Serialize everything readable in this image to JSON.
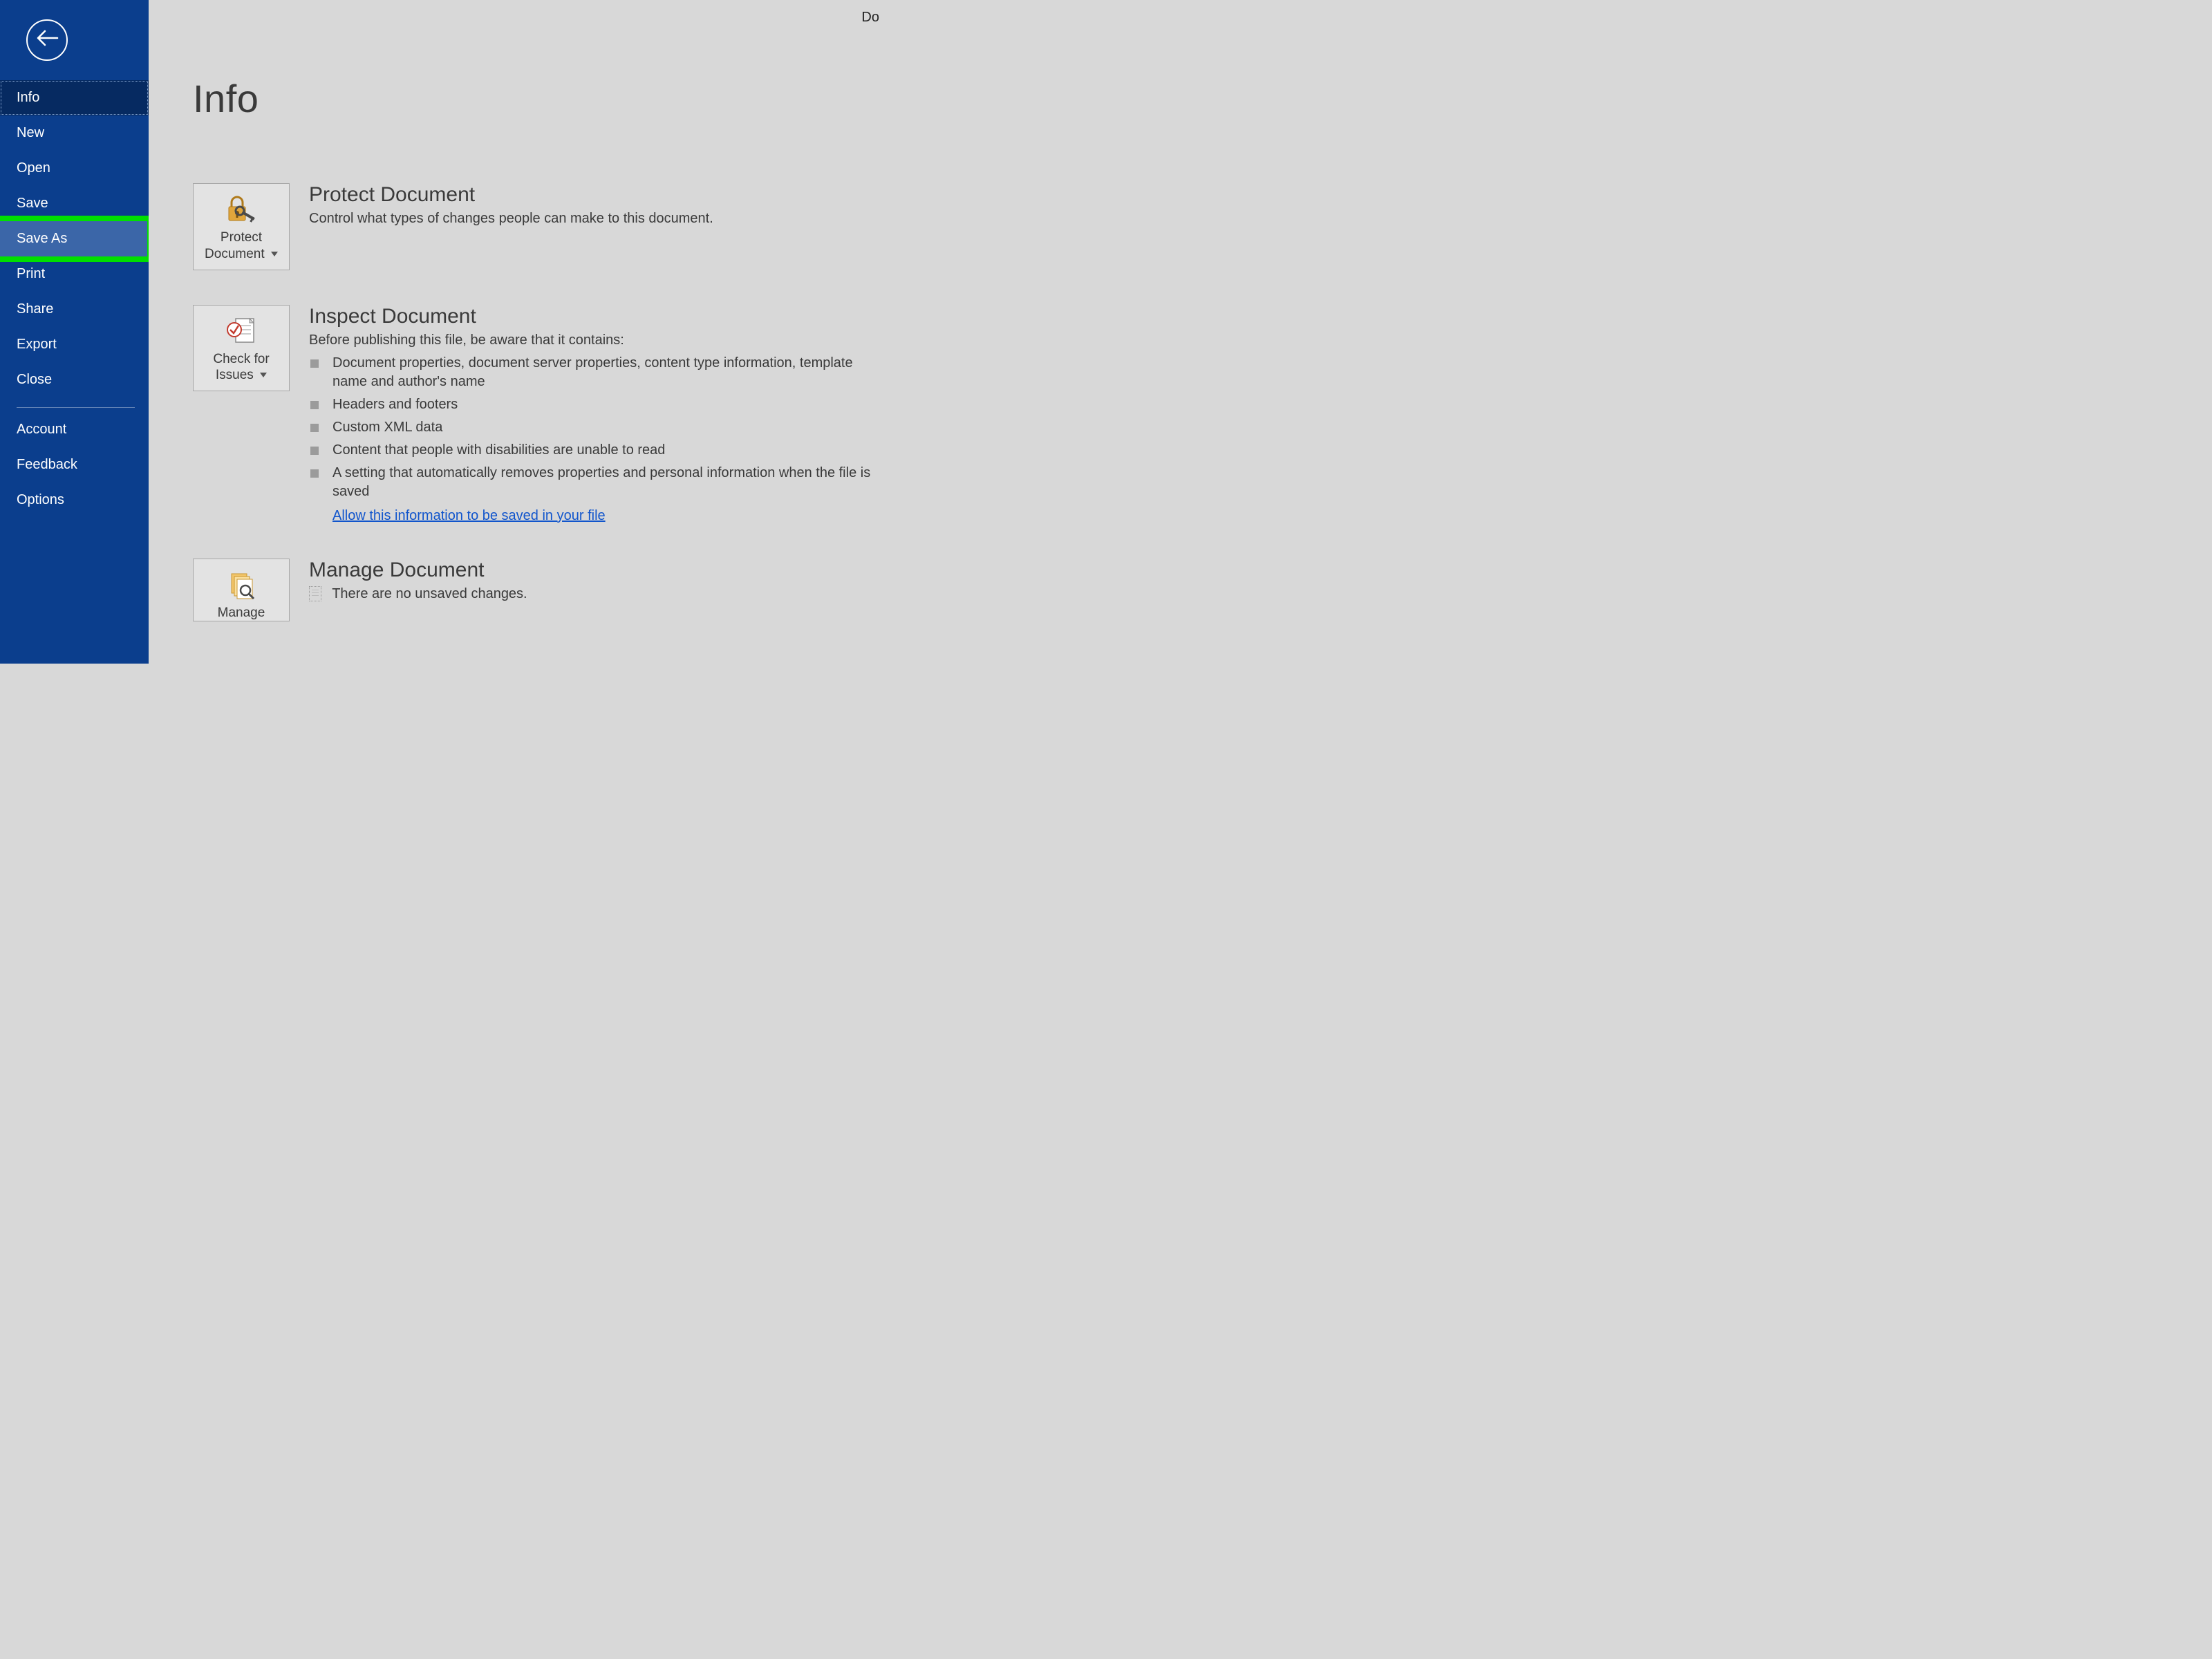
{
  "topRight": "Do",
  "sidebar": {
    "items": [
      {
        "label": "Info",
        "state": "selected"
      },
      {
        "label": "New",
        "state": ""
      },
      {
        "label": "Open",
        "state": ""
      },
      {
        "label": "Save",
        "state": ""
      },
      {
        "label": "Save As",
        "state": "highlight"
      },
      {
        "label": "Print",
        "state": ""
      },
      {
        "label": "Share",
        "state": ""
      },
      {
        "label": "Export",
        "state": ""
      },
      {
        "label": "Close",
        "state": ""
      }
    ],
    "footerItems": [
      {
        "label": "Account"
      },
      {
        "label": "Feedback"
      },
      {
        "label": "Options"
      }
    ]
  },
  "main": {
    "title": "Info",
    "protect": {
      "tileLabel": "Protect Document",
      "heading": "Protect Document",
      "desc": "Control what types of changes people can make to this document."
    },
    "inspect": {
      "tileLabel": "Check for Issues",
      "heading": "Inspect Document",
      "desc": "Before publishing this file, be aware that it contains:",
      "bullets": [
        "Document properties, document server properties, content type information, template name and author's name",
        "Headers and footers",
        "Custom XML data",
        "Content that people with disabilities are unable to read",
        "A setting that automatically removes properties and personal information when the file is saved"
      ],
      "link": "Allow this information to be saved in your file"
    },
    "manage": {
      "tileLabel": "Manage",
      "heading": "Manage Document",
      "desc": "There are no unsaved changes."
    }
  }
}
